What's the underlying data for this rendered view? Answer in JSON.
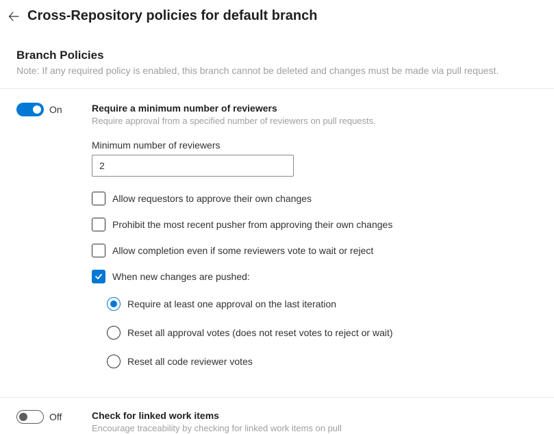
{
  "header": {
    "title": "Cross-Repository policies for default branch"
  },
  "section": {
    "title": "Branch Policies",
    "note": "Note: If any required policy is enabled, this branch cannot be deleted and changes must be made via pull request."
  },
  "policies": {
    "min_reviewers": {
      "toggle_state": "On",
      "title": "Require a minimum number of reviewers",
      "desc": "Require approval from a specified number of reviewers on pull requests.",
      "field_label": "Minimum number of reviewers",
      "field_value": "2",
      "checkboxes": {
        "allow_requestors": "Allow requestors to approve their own changes",
        "prohibit_recent": "Prohibit the most recent pusher from approving their own changes",
        "allow_completion": "Allow completion even if some reviewers vote to wait or reject",
        "when_pushed": "When new changes are pushed:"
      },
      "radios": {
        "require_one": "Require at least one approval on the last iteration",
        "reset_approval": "Reset all approval votes (does not reset votes to reject or wait)",
        "reset_all": "Reset all code reviewer votes"
      }
    },
    "linked_work_items": {
      "toggle_state": "Off",
      "title": "Check for linked work items",
      "desc": "Encourage traceability by checking for linked work items on pull"
    }
  }
}
